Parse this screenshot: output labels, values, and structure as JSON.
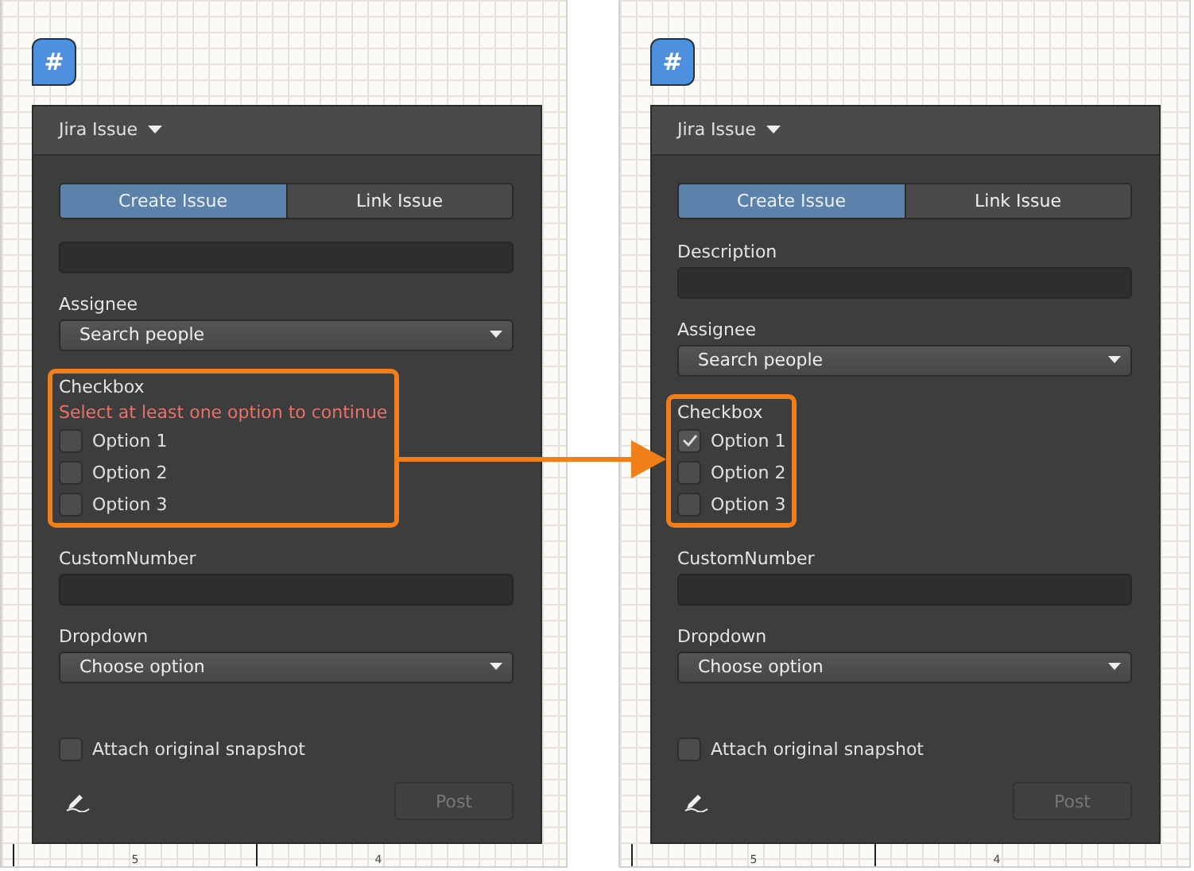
{
  "canvases": [
    {
      "badge": "#",
      "title": "Jira Issue",
      "tabs": [
        {
          "label": "Create Issue",
          "selected": true
        },
        {
          "label": "Link Issue",
          "selected": false
        }
      ],
      "fields": [
        {
          "kind": "text"
        },
        {
          "kind": "select",
          "label": "Assignee",
          "value": "Search people"
        },
        {
          "kind": "checkgroup",
          "label": "Checkbox",
          "error": "Select at least one option to continue",
          "options": [
            {
              "label": "Option 1",
              "checked": false
            },
            {
              "label": "Option 2",
              "checked": false
            },
            {
              "label": "Option 3",
              "checked": false
            }
          ]
        },
        {
          "kind": "text",
          "label": "CustomNumber"
        },
        {
          "kind": "select",
          "label": "Dropdown",
          "value": "Choose option"
        },
        {
          "kind": "checkbox",
          "label": "Attach original snapshot",
          "checked": false
        }
      ],
      "post": {
        "label": "Post",
        "disabled": true
      },
      "ruler": [
        "5",
        "4"
      ]
    },
    {
      "badge": "#",
      "title": "Jira Issue",
      "tabs": [
        {
          "label": "Create Issue",
          "selected": true
        },
        {
          "label": "Link Issue",
          "selected": false
        }
      ],
      "fields": [
        {
          "kind": "text",
          "label": "Description"
        },
        {
          "kind": "select",
          "label": "Assignee",
          "value": "Search people"
        },
        {
          "kind": "checkgroup",
          "label": "Checkbox",
          "options": [
            {
              "label": "Option 1",
              "checked": true
            },
            {
              "label": "Option 2",
              "checked": false
            },
            {
              "label": "Option 3",
              "checked": false
            }
          ]
        },
        {
          "kind": "text",
          "label": "CustomNumber"
        },
        {
          "kind": "select",
          "label": "Dropdown",
          "value": "Choose option"
        },
        {
          "kind": "checkbox",
          "label": "Attach original snapshot",
          "checked": false
        }
      ],
      "post": {
        "label": "Post",
        "disabled": true
      },
      "ruler": [
        "5",
        "4"
      ]
    }
  ]
}
